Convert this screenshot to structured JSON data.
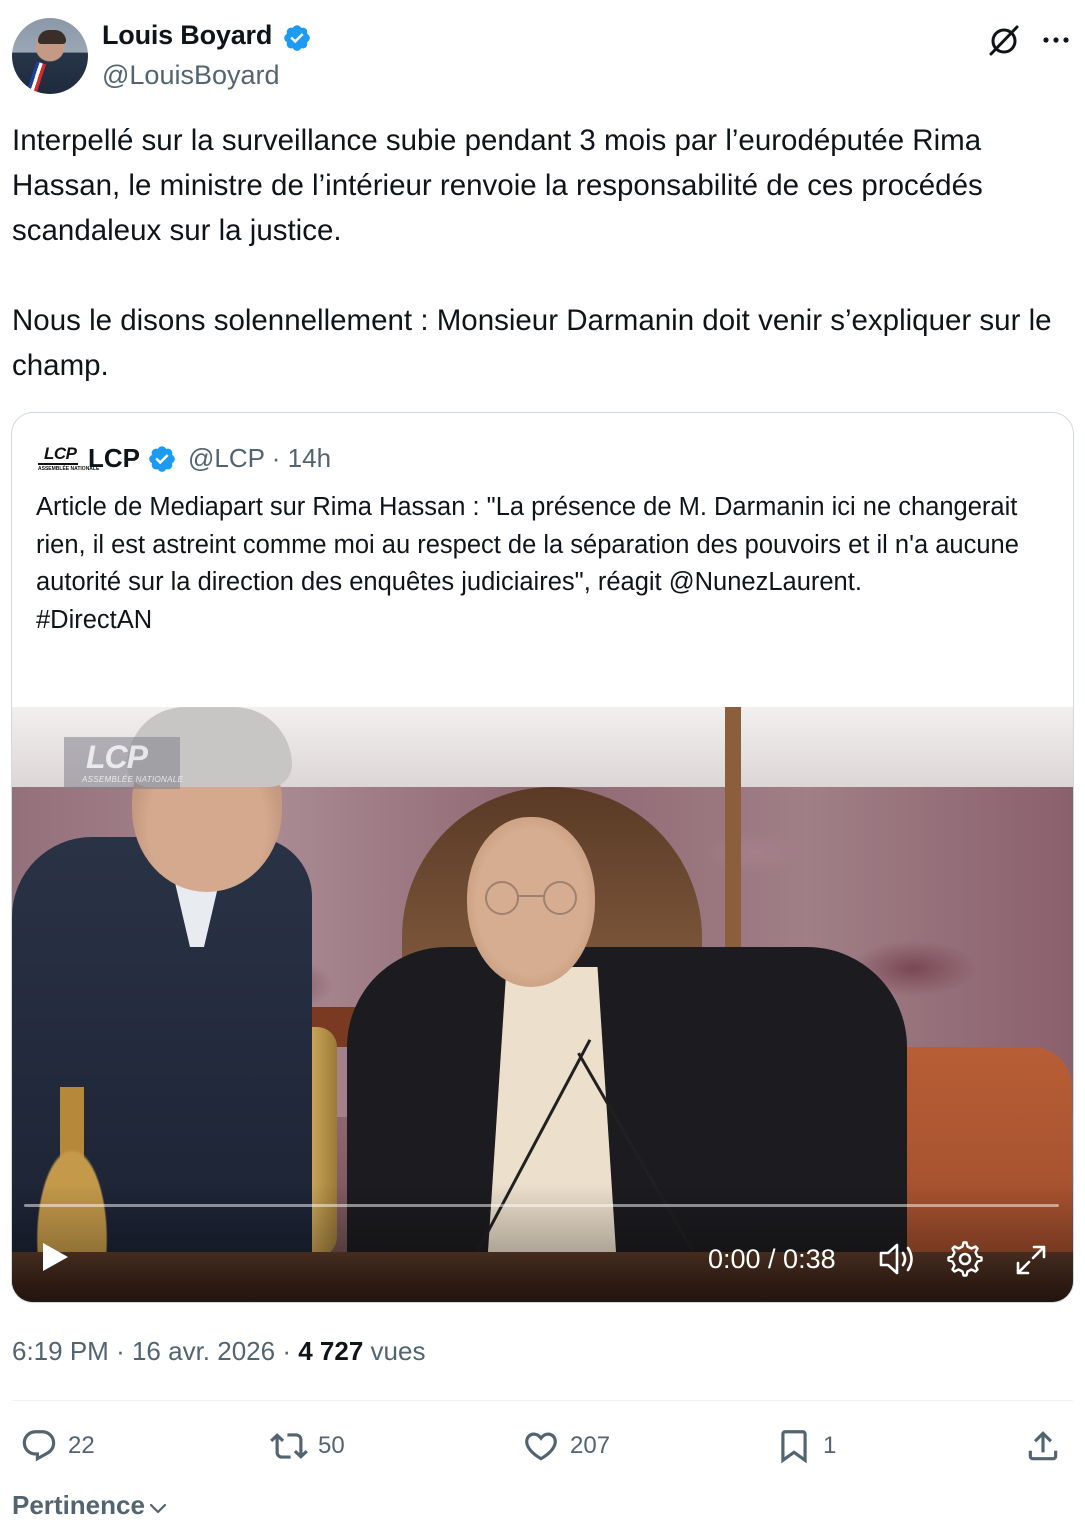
{
  "author": {
    "name": "Louis Boyard",
    "handle": "@LouisBoyard"
  },
  "tweet": {
    "text": "Interpellé sur la surveillance subie pendant 3 mois par l’eurodéputée Rima Hassan, le ministre de l’intérieur renvoie la responsabilité de ces procédés scandaleux sur la justice.\n\nNous le disons solennellement : Monsieur Darmanin doit venir s’expliquer sur le champ."
  },
  "quote": {
    "logo_text": "LCP",
    "logo_subtext": "ASSEMBLÉE NATIONALE",
    "name": "LCP",
    "handle": "@LCP",
    "separator": "·",
    "age": "14h",
    "text": "Article de Mediapart sur Rima Hassan : \"La présence de M. Darmanin ici ne changerait rien, il est astreint comme moi au respect de la séparation des pouvoirs et il n'a aucune autorité sur la direction des enquêtes judiciaires\", réagit @NunezLaurent.\n#DirectAN",
    "video": {
      "watermark": "LCP",
      "watermark_sub": "ASSEMBLÉE NATIONALE",
      "time_current": "0:00",
      "time_total": "0:38",
      "time_label": "0:00 / 0:38",
      "progress_fraction": 0
    }
  },
  "meta": {
    "time": "6:19 PM",
    "date": "16 avr. 2026",
    "views": "4 727",
    "views_label": "vues",
    "sep": "·"
  },
  "actions": {
    "replies": "22",
    "reposts": "50",
    "likes": "207",
    "bookmarks": "1"
  },
  "sort": {
    "label": "Pertinence"
  },
  "colors": {
    "verified": "#1d9bf0",
    "text": "#0f1419",
    "secondary": "#536471",
    "border": "#cfd9de"
  },
  "icons": {
    "grok": "grok-icon",
    "more": "more-icon",
    "reply": "reply-icon",
    "repost": "repost-icon",
    "like": "like-icon",
    "bookmark": "bookmark-icon",
    "share": "share-icon"
  }
}
